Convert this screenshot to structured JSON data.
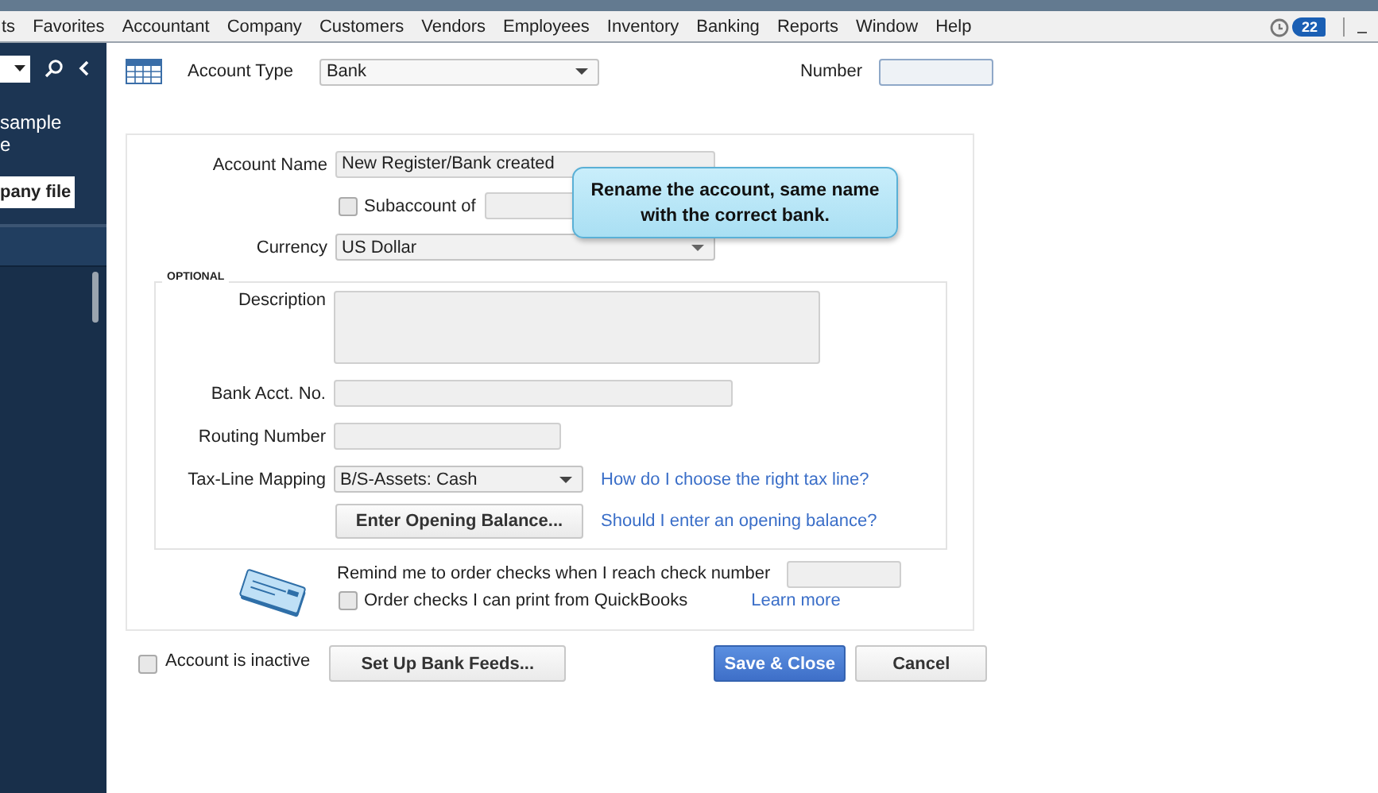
{
  "menu_bar": {
    "items": [
      "ts",
      "Favorites",
      "Accountant",
      "Company",
      "Customers",
      "Vendors",
      "Employees",
      "Inventory",
      "Banking",
      "Reports",
      "Window",
      "Help"
    ],
    "reminder_count": "22"
  },
  "sidebar": {
    "text_lines": [
      "sample",
      "e"
    ],
    "button": "pany file"
  },
  "header": {
    "account_type_label": "Account Type",
    "account_type": "Bank",
    "number_label": "Number"
  },
  "form": {
    "account_name_label": "Account Name",
    "account_name": "New Register/Bank created",
    "subaccount": {
      "label": "Subaccount of",
      "checked": false
    },
    "currency_label": "Currency",
    "currency": "US Dollar",
    "optional": {
      "legend": "OPTIONAL",
      "description_label": "Description",
      "bank_acct_label": "Bank Acct. No.",
      "routing_label": "Routing Number",
      "tax_line_label": "Tax-Line Mapping",
      "tax_line": "B/S-Assets: Cash",
      "tax_line_link": "How do I choose the right tax line?",
      "opening_balance_button": "Enter Opening Balance...",
      "opening_balance_link": "Should I enter an opening balance?"
    },
    "checks": {
      "remind_label": "Remind me to order checks when I reach check number",
      "order_checks": {
        "label": "Order checks I can print from QuickBooks",
        "checked": false
      },
      "learn_more": "Learn more"
    }
  },
  "footer": {
    "inactive": {
      "label": "Account is inactive",
      "checked": false
    },
    "bank_feeds_button": "Set Up Bank Feeds...",
    "save_button": "Save & Close",
    "cancel_button": "Cancel"
  },
  "tooltip": "Rename the account, same name with the correct bank."
}
